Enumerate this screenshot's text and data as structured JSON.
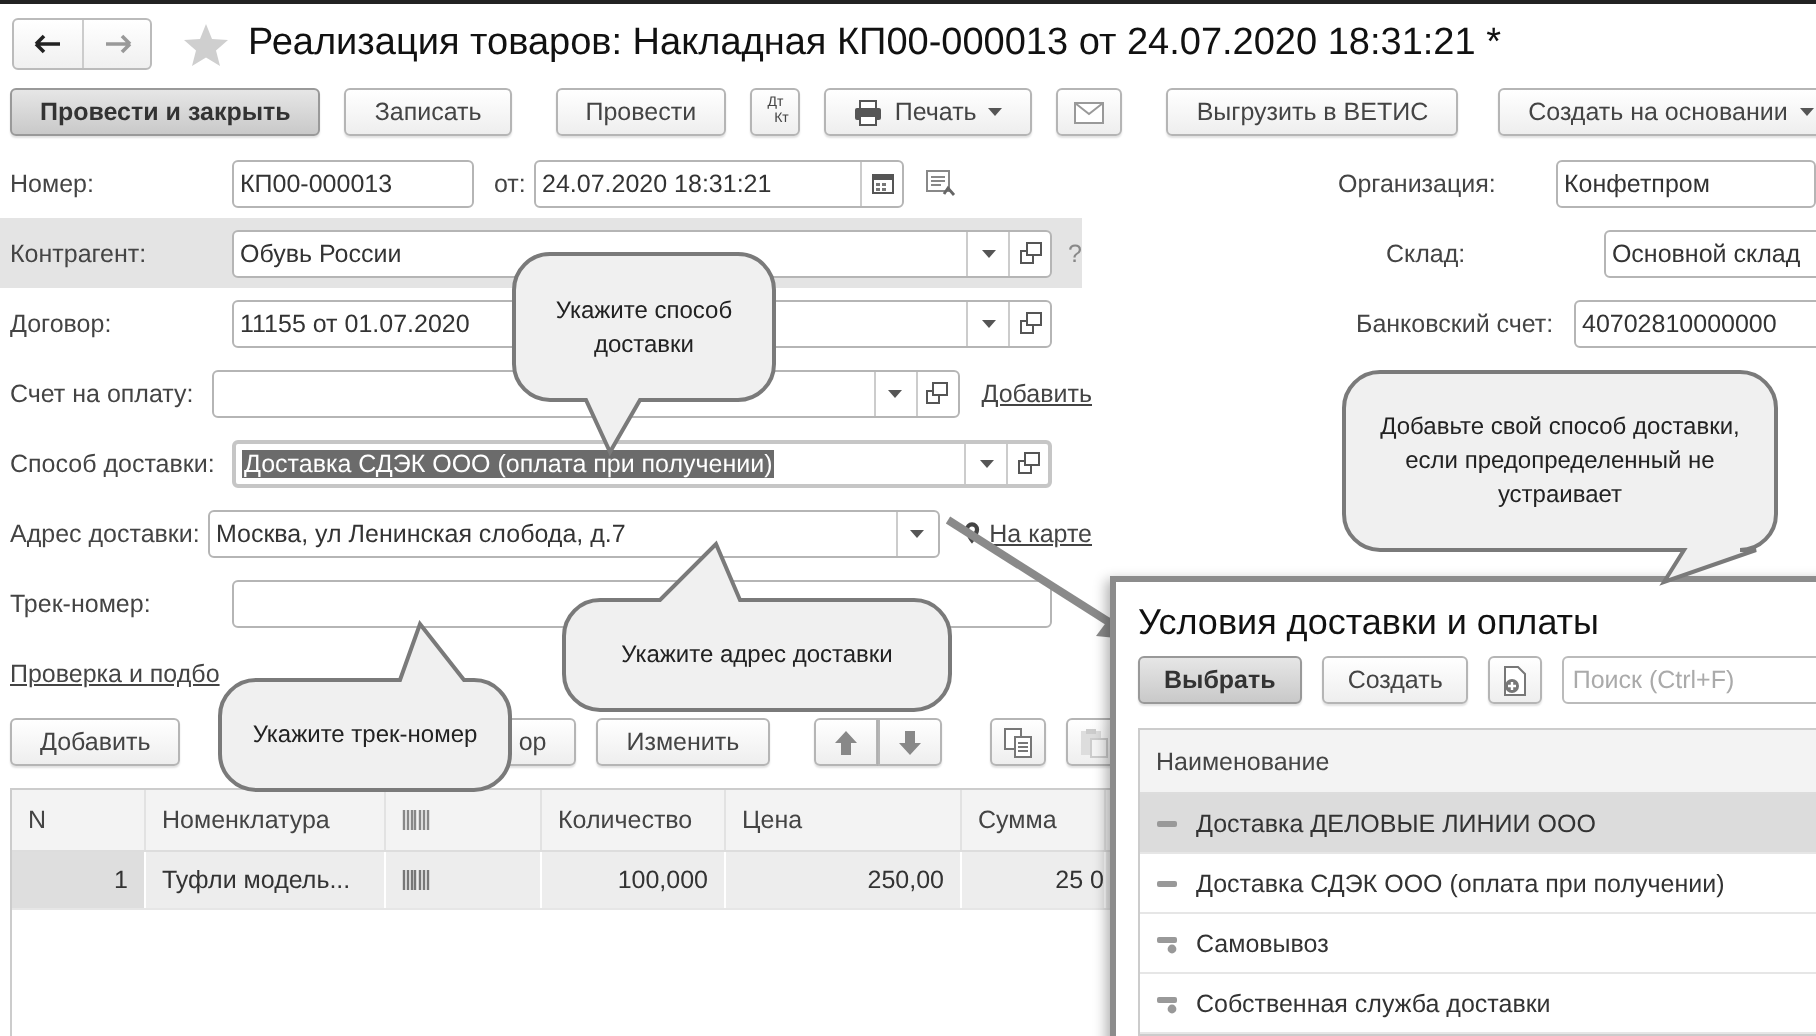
{
  "window": {
    "title": "Реализация товаров: Накладная КП00-000013 от 24.07.2020 18:31:21 *",
    "favorite": false
  },
  "toolbar": [
    {
      "kind": "default",
      "label": "Провести и закрыть"
    },
    {
      "kind": "button",
      "label": "Записать"
    },
    {
      "kind": "button",
      "label": "Провести"
    },
    {
      "kind": "dtkt",
      "label": "Дт",
      "sublabel": "Кт"
    },
    {
      "kind": "menu",
      "label": "Печать"
    },
    {
      "kind": "mail"
    },
    {
      "kind": "button",
      "label": "Выгрузить в ВЕТИС"
    },
    {
      "kind": "menu",
      "label": "Создать на основании"
    }
  ],
  "header": {
    "number_label": "Номер:",
    "number": "КП00-000013",
    "date_label": "от:",
    "date": "24.07.2020 18:31:21"
  },
  "fields": [
    {
      "label": "Контрагент:",
      "value": "Обувь России",
      "buttons": [
        {
          "kind": "dropdown"
        },
        {
          "kind": "open"
        }
      ],
      "highlighted": true,
      "focused": false,
      "help": "?"
    },
    {
      "label": "Договор:",
      "value": "11155 от 01.07.2020",
      "buttons": [
        {
          "kind": "dropdown"
        },
        {
          "kind": "open"
        }
      ],
      "highlighted": false,
      "focused": false
    },
    {
      "label": "Счет на оплату:",
      "buttons": [
        {
          "kind": "dropdown"
        },
        {
          "kind": "open"
        }
      ],
      "highlighted": false,
      "focused": false,
      "link": {
        "kind": "plain",
        "text": "Добавить"
      }
    },
    {
      "label": "Способ доставки:",
      "value": "Доставка СДЭК ООО (оплата при получении)",
      "buttons": [
        {
          "kind": "dropdown"
        },
        {
          "kind": "open"
        }
      ],
      "highlighted": false,
      "focused": true
    },
    {
      "label": "Адрес доставки:",
      "value": "Москва, ул Ленинская слобода, д.7",
      "buttons": [
        {
          "kind": "dropdown"
        }
      ],
      "highlighted": false,
      "focused": false,
      "link": {
        "kind": "map",
        "text": "На карте"
      }
    },
    {
      "label": "Трек-номер:",
      "highlighted": false,
      "focused": false
    }
  ],
  "right_fields": [
    {
      "label": "Организация:",
      "value": "Конфетпром"
    },
    {
      "label": "Склад:",
      "value": "Основной склад"
    },
    {
      "label": "Банковский счет:",
      "value": "40702810000000"
    }
  ],
  "check_link": "Проверка и подбо",
  "table_toolbar": [
    {
      "kind": "button",
      "label": "Добавить",
      "disabled": false
    },
    {
      "kind": "button",
      "label": "ор",
      "disabled": false
    },
    {
      "kind": "button",
      "label": "Изменить",
      "disabled": false
    },
    {
      "kind": "up",
      "disabled": false
    },
    {
      "kind": "down",
      "disabled": false
    },
    {
      "kind": "copy",
      "disabled": false
    },
    {
      "kind": "paste",
      "disabled": true
    }
  ],
  "table": {
    "columns": [
      {
        "kind": "text",
        "label": "N"
      },
      {
        "kind": "text",
        "label": "Номенклатура"
      },
      {
        "kind": "icon"
      },
      {
        "kind": "text",
        "label": "Количество"
      },
      {
        "kind": "text",
        "label": "Цена"
      },
      {
        "kind": "text",
        "label": "Сумма"
      }
    ],
    "rows": [
      {
        "selected": true,
        "cells": [
          {
            "kind": "number",
            "text": "1"
          },
          {
            "kind": "text",
            "text": "Туфли модель..."
          },
          {
            "kind": "icon"
          },
          {
            "kind": "number",
            "text": "100,000"
          },
          {
            "kind": "number",
            "text": "250,00"
          },
          {
            "kind": "number",
            "text": "25 0"
          }
        ]
      }
    ]
  },
  "popup": {
    "title": "Условия доставки и оплаты",
    "buttons": [
      {
        "kind": "default",
        "label": "Выбрать"
      },
      {
        "kind": "button",
        "label": "Создать"
      },
      {
        "kind": "icon"
      }
    ],
    "search": {
      "placeholder": "Поиск (Ctrl+F)"
    },
    "column": "Наименование",
    "items": [
      {
        "kind": "element",
        "name": "Доставка ДЕЛОВЫЕ ЛИНИИ ООО",
        "selected": true
      },
      {
        "kind": "element",
        "name": "Доставка СДЭК ООО (оплата при получении)",
        "selected": false
      },
      {
        "kind": "predefined",
        "name": "Самовывоз",
        "selected": false
      },
      {
        "kind": "predefined",
        "name": "Собственная служба доставки",
        "selected": false
      }
    ]
  },
  "callouts": [
    "Укажите способ доставки",
    "Добавьте свой способ доставки, если предопределенный не устраивает",
    "Укажите адрес доставки",
    "Укажите трек-номер"
  ]
}
